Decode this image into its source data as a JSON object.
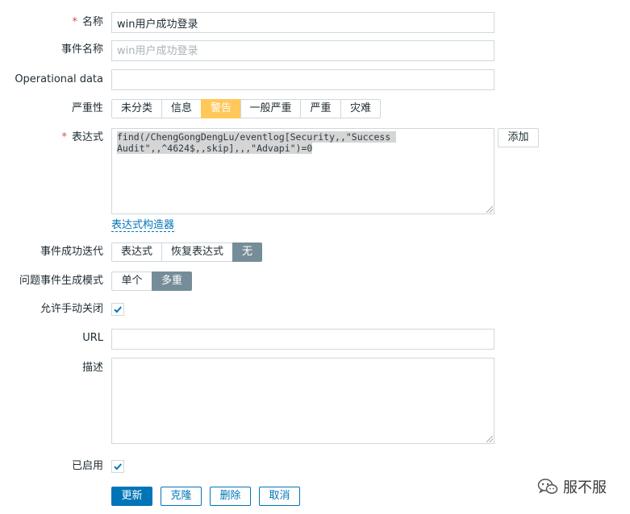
{
  "form": {
    "name": {
      "label": "名称",
      "required_mark": "*",
      "value": "win用户成功登录"
    },
    "event_name": {
      "label": "事件名称",
      "placeholder": "win用户成功登录"
    },
    "operational_data": {
      "label": "Operational data",
      "value": ""
    },
    "severity": {
      "label": "严重性",
      "options": [
        "未分类",
        "信息",
        "警告",
        "一般严重",
        "严重",
        "灾难"
      ],
      "selected": "警告"
    },
    "expression": {
      "label": "表达式",
      "required_mark": "*",
      "line1": "find(/ChengGongDengLu/eventlog[Security,,\"Success ",
      "line2": "Audit\",,^4624$,,skip],,,\"Advapi\")=0",
      "add_button": "添加",
      "builder_link": "表达式构造器"
    },
    "recovery": {
      "label": "事件成功迭代",
      "options": [
        "表达式",
        "恢复表达式",
        "无"
      ],
      "selected": "无"
    },
    "problem_mode": {
      "label": "问题事件生成模式",
      "options": [
        "单个",
        "多重"
      ],
      "selected": "多重"
    },
    "manual_close": {
      "label": "允许手动关闭",
      "checked": true
    },
    "url": {
      "label": "URL",
      "value": ""
    },
    "description": {
      "label": "描述",
      "value": ""
    },
    "enabled": {
      "label": "已启用",
      "checked": true
    }
  },
  "actions": {
    "update": "更新",
    "clone": "克隆",
    "delete": "删除",
    "cancel": "取消"
  },
  "watermark": {
    "text": "服不服",
    "icon": "wechat-icon"
  },
  "colors": {
    "primary": "#0275b8",
    "severity_warning": "#ffc859",
    "segment_active": "#768d99",
    "required": "#d64e4e"
  }
}
